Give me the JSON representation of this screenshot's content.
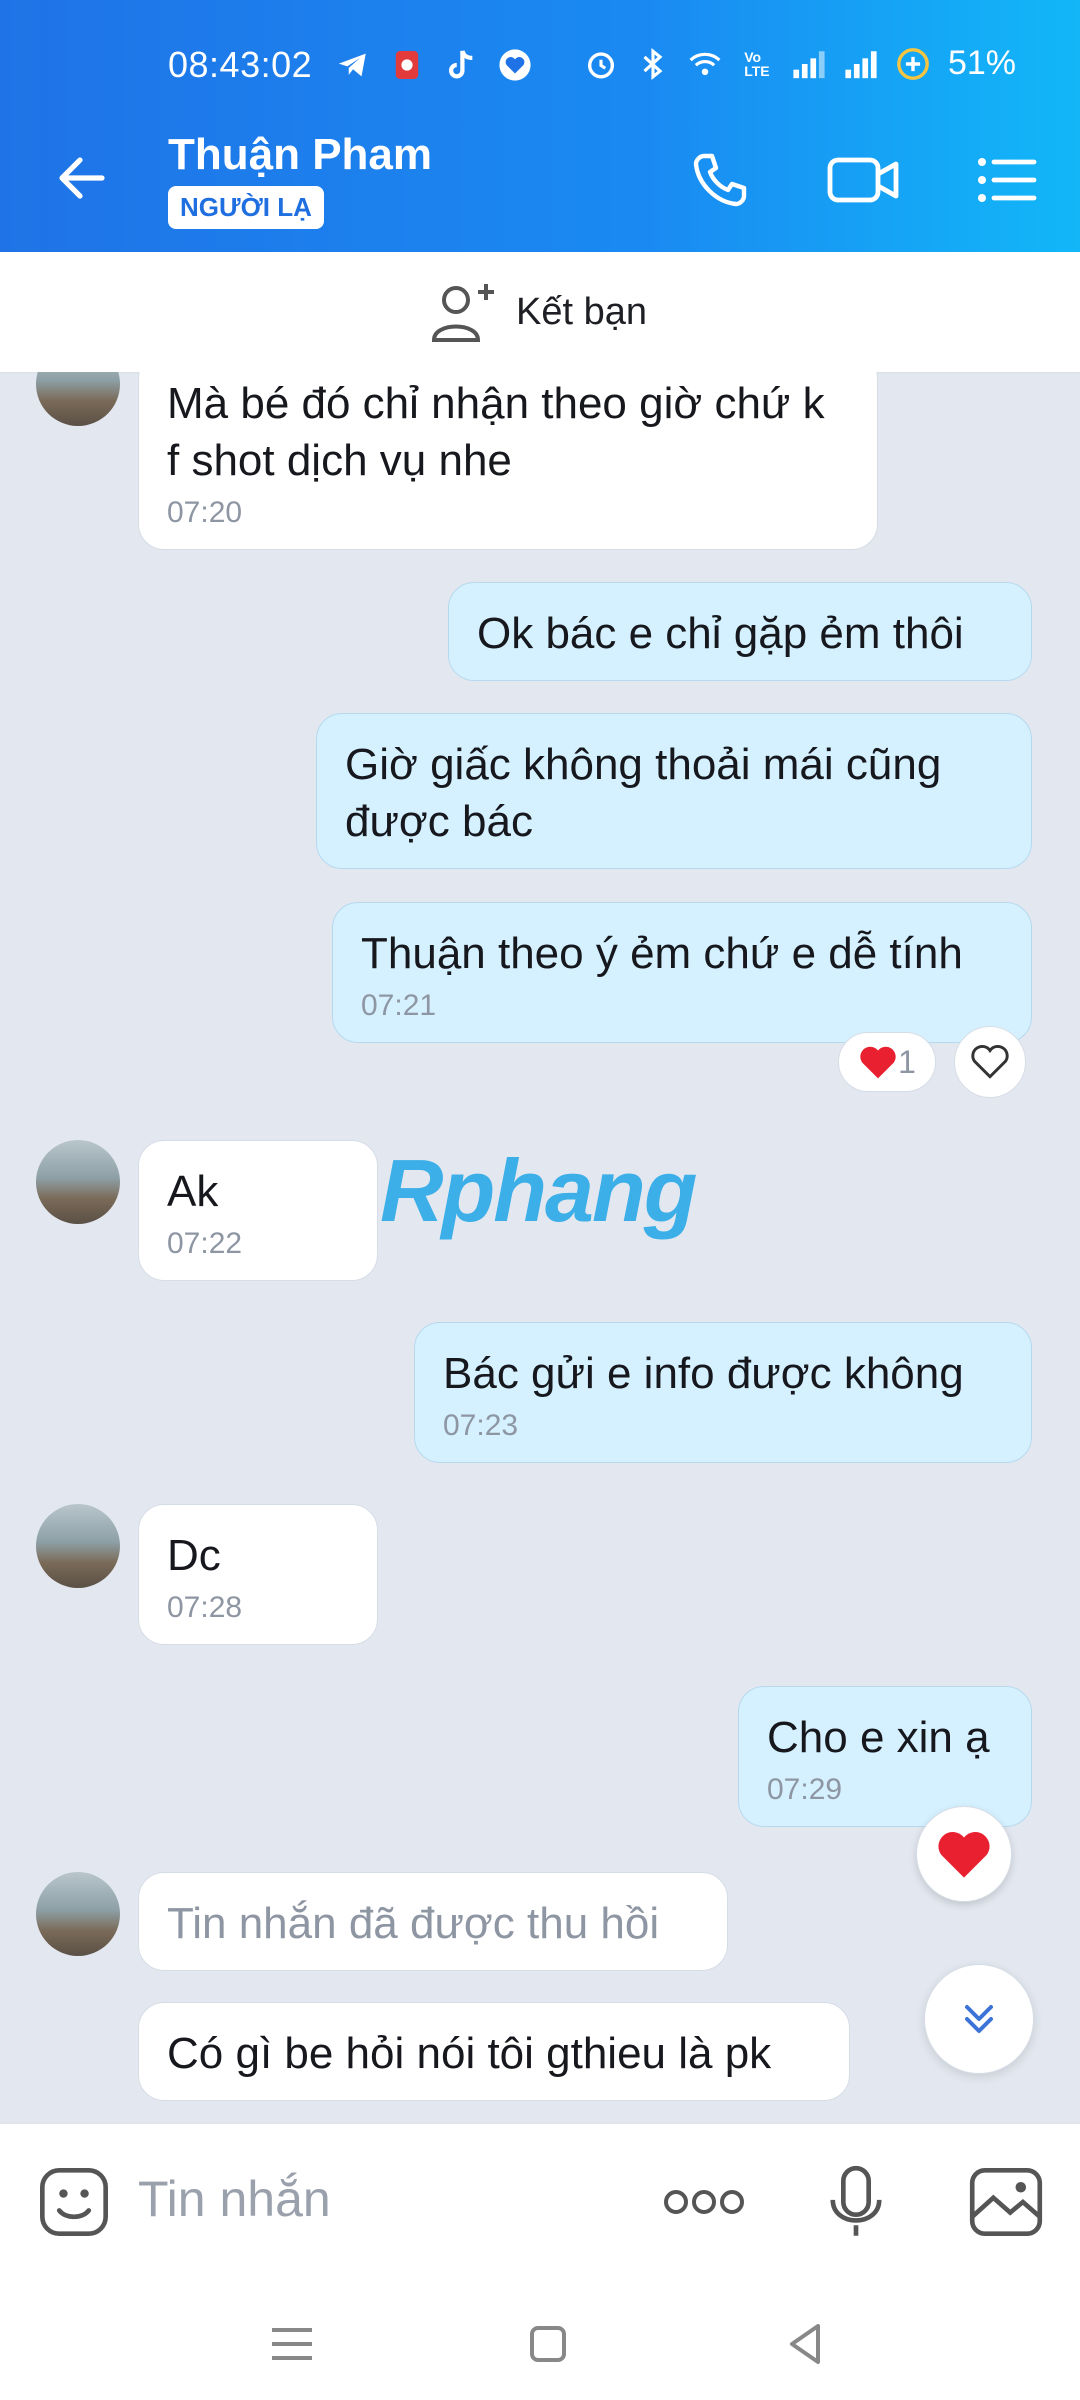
{
  "status_bar": {
    "time": "08:43:02",
    "battery": "51%",
    "icons": [
      "telegram-icon",
      "notification-icon",
      "tiktok-icon",
      "heart-shield-icon",
      "alarm-icon",
      "bluetooth-icon",
      "wifi-icon",
      "volte-icon",
      "signal-icon",
      "signal-icon",
      "battery-saver-icon"
    ]
  },
  "header": {
    "contact_name": "Thuận Pham",
    "badge": "NGƯỜI LẠ"
  },
  "add_friend": {
    "label": "Kết bạn"
  },
  "messages": [
    {
      "side": "them",
      "text": "Mà bé đó chỉ nhận theo giờ chứ k f shot dịch vụ nhe",
      "time": "07:20"
    },
    {
      "side": "me",
      "text": "Ok bác e chỉ gặp ẻm thôi"
    },
    {
      "side": "me",
      "text": "Giờ giấc không thoải mái cũng được bác"
    },
    {
      "side": "me",
      "text": "Thuận theo ý ẻm chứ e dễ tính",
      "time": "07:21",
      "reaction_count": "1"
    },
    {
      "side": "them",
      "text": "Ak",
      "time": "07:22"
    },
    {
      "side": "me",
      "text": "Bác gửi e info được không",
      "time": "07:23"
    },
    {
      "side": "them",
      "text": "Dc",
      "time": "07:28"
    },
    {
      "side": "me",
      "text": "Cho e xin ạ",
      "time": "07:29"
    },
    {
      "side": "them",
      "text": "Tin nhắn đã được thu hồi",
      "recalled": true
    },
    {
      "side": "them",
      "text": "Có gì be hỏi nói tôi gthieu là pk"
    }
  ],
  "watermark": {
    "text": "Rphang"
  },
  "input": {
    "placeholder": "Tin nhắn"
  },
  "colors": {
    "header_start": "#1f73e6",
    "header_end": "#12b7f8",
    "my_bubble": "#d5f1ff",
    "chat_bg": "#e3e8f0",
    "heart": "#e8202f"
  }
}
